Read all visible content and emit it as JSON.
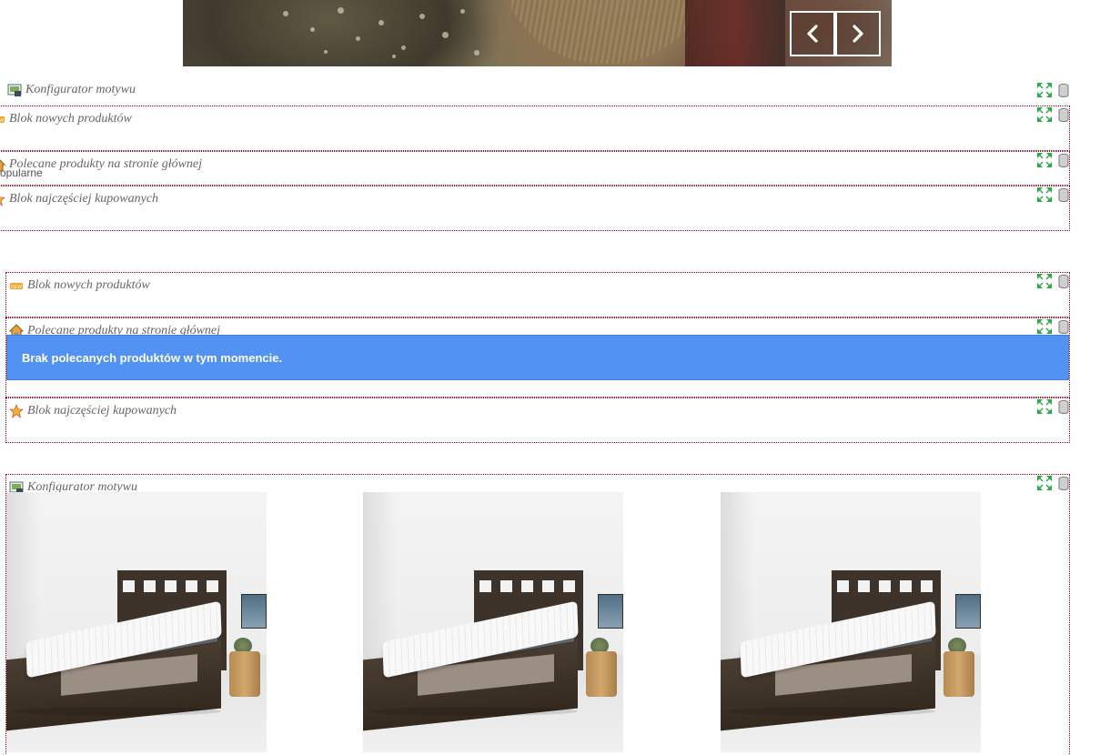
{
  "slider": {
    "prev_icon": "chevron-left-icon",
    "next_icon": "chevron-right-icon"
  },
  "modules": {
    "m1": {
      "title": "Konfigurator motywu",
      "icon": "theme-configurator-icon"
    },
    "m2": {
      "title": "Blok nowych produktów",
      "icon": "new-products-icon"
    },
    "m3": {
      "title": "Polecane produkty na stronie głównej",
      "icon": "home-icon",
      "sublabel": "opularne"
    },
    "m4": {
      "title": "Blok najczęściej kupowanych",
      "icon": "bestseller-icon"
    },
    "m5": {
      "title": "Blok nowych produktów",
      "icon": "new-products-icon"
    },
    "m6": {
      "title": "Polecane produkty na stronie głównej",
      "icon": "home-icon"
    },
    "m7": {
      "title": "Blok najczęściej kupowanych",
      "icon": "bestseller-icon"
    },
    "m8": {
      "title": "Konfigurator motywu",
      "icon": "theme-configurator-icon"
    }
  },
  "notice": {
    "text": "Brak polecanych produktów w tym momencie."
  },
  "controls": {
    "move_icon": "move-icon",
    "delete_icon": "trash-icon"
  },
  "colors": {
    "module_border": "#a8001c",
    "notice_bg": "#5192f2",
    "title_text": "#666666",
    "move_icon": "#2fa84a"
  }
}
